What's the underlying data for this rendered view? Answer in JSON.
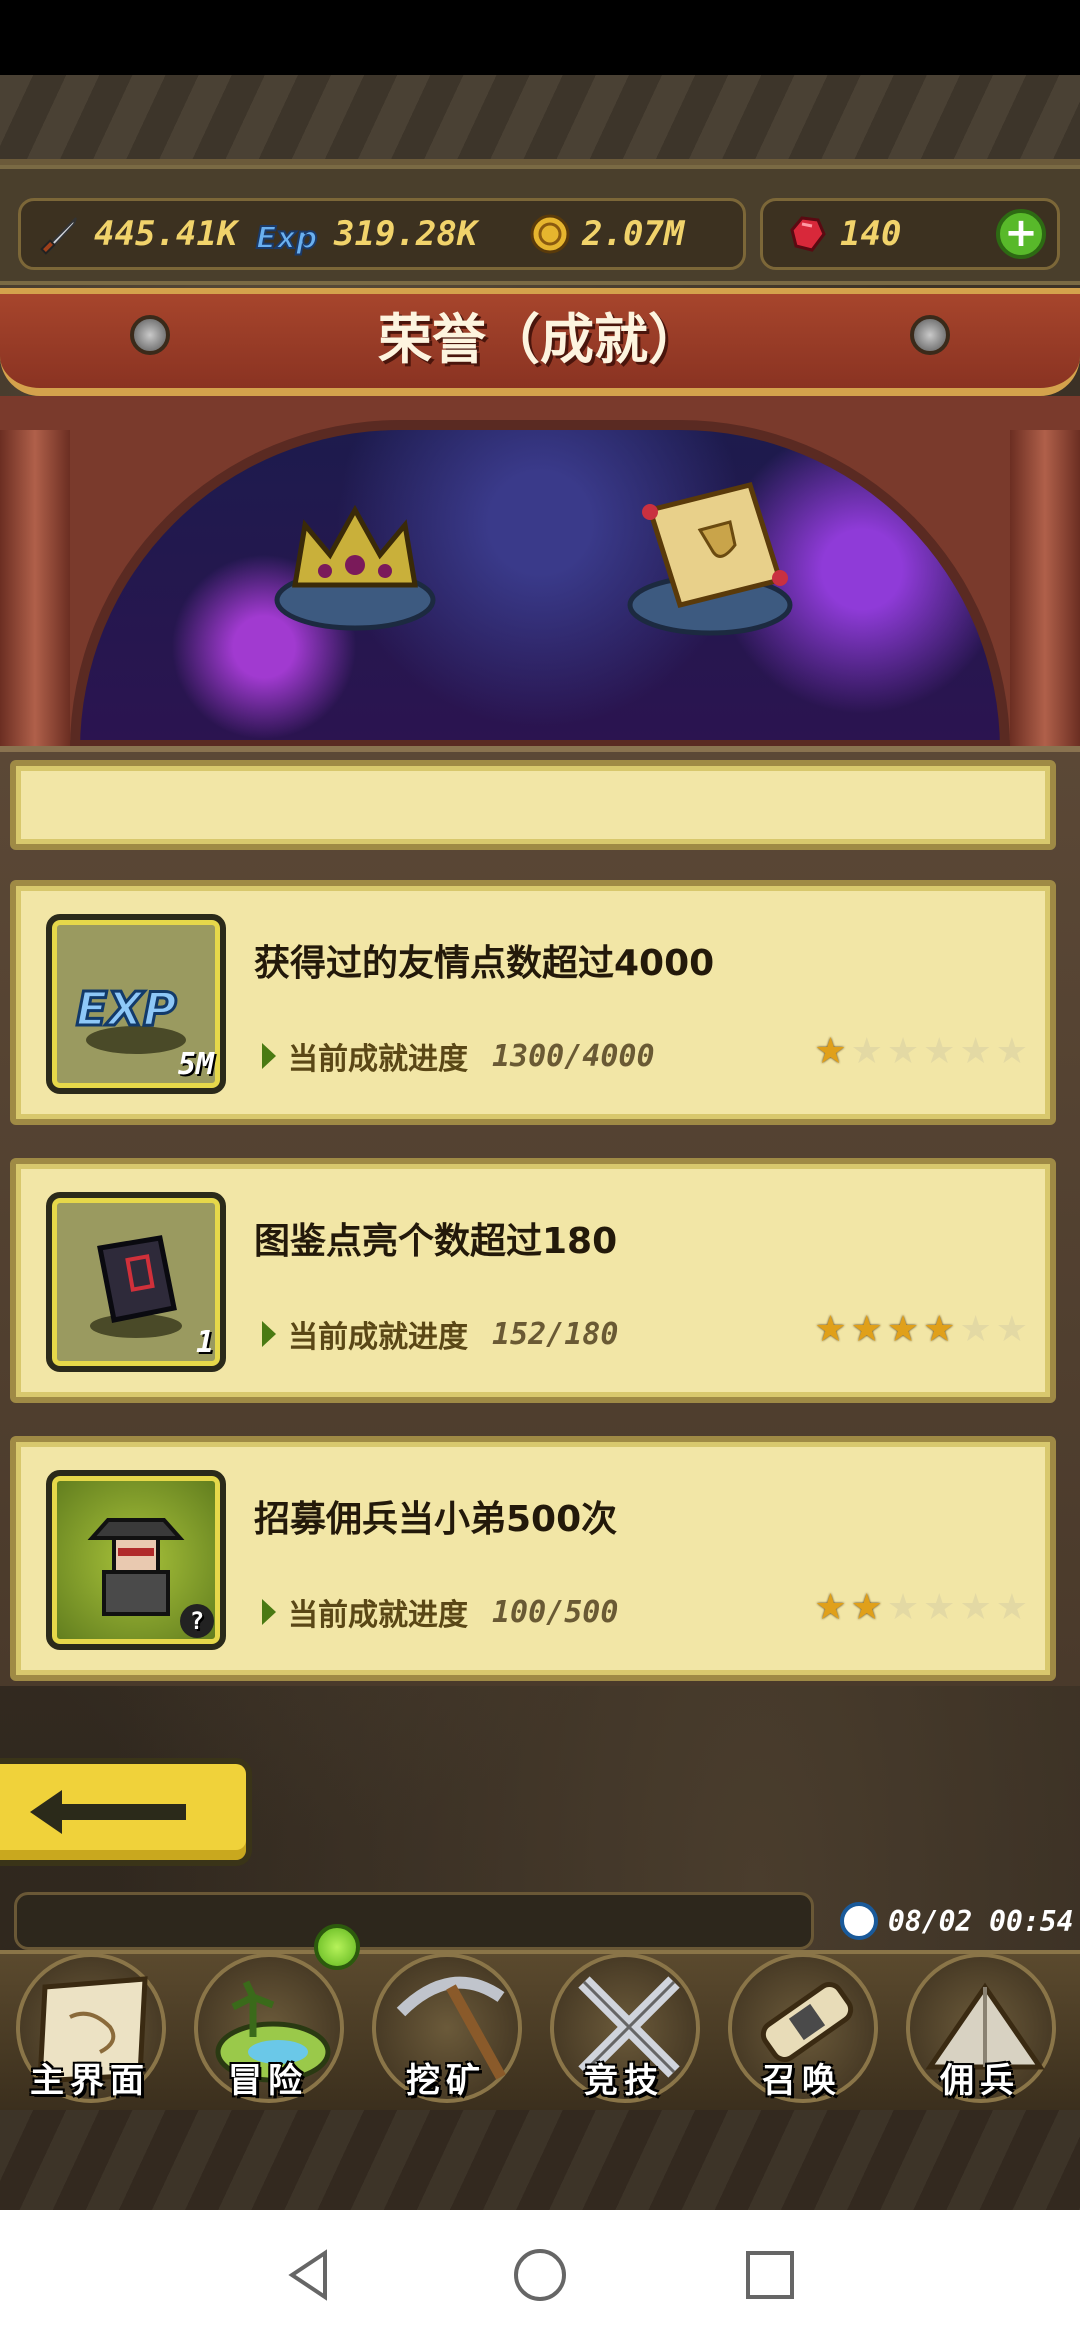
{
  "resources": {
    "power": "445.41K",
    "exp": "319.28K",
    "gold": "2.07M",
    "gems": "140"
  },
  "header": {
    "title": "荣誉（成就）"
  },
  "achievements": [
    {
      "title": "获得过的友情点数超过4000",
      "progress_label": "当前成就进度",
      "progress": "1300/4000",
      "stars_filled": 1,
      "stars_total": 6,
      "reward_badge": "5M",
      "icon": "exp-icon"
    },
    {
      "title": "图鉴点亮个数超过180",
      "progress_label": "当前成就进度",
      "progress": "152/180",
      "stars_filled": 4,
      "stars_total": 6,
      "reward_badge": "1",
      "icon": "book-icon"
    },
    {
      "title": "招募佣兵当小弟500次",
      "progress_label": "当前成就进度",
      "progress": "100/500",
      "stars_filled": 2,
      "stars_total": 6,
      "reward_badge": "?",
      "icon": "mercenary-icon"
    }
  ],
  "time": "08/02 00:54",
  "nav": {
    "items": [
      {
        "label": "主界面",
        "icon": "map-scroll-icon"
      },
      {
        "label": "冒险",
        "icon": "island-icon"
      },
      {
        "label": "挖矿",
        "icon": "pickaxe-icon"
      },
      {
        "label": "竞技",
        "icon": "crossed-swords-icon"
      },
      {
        "label": "召唤",
        "icon": "summon-scroll-icon"
      },
      {
        "label": "佣兵",
        "icon": "tent-icon"
      }
    ]
  },
  "colors": {
    "card_bg": "#f2e6a6",
    "banner": "#a7452c",
    "star_on": "#e0a01a",
    "accent_yellow": "#f0d23a"
  }
}
